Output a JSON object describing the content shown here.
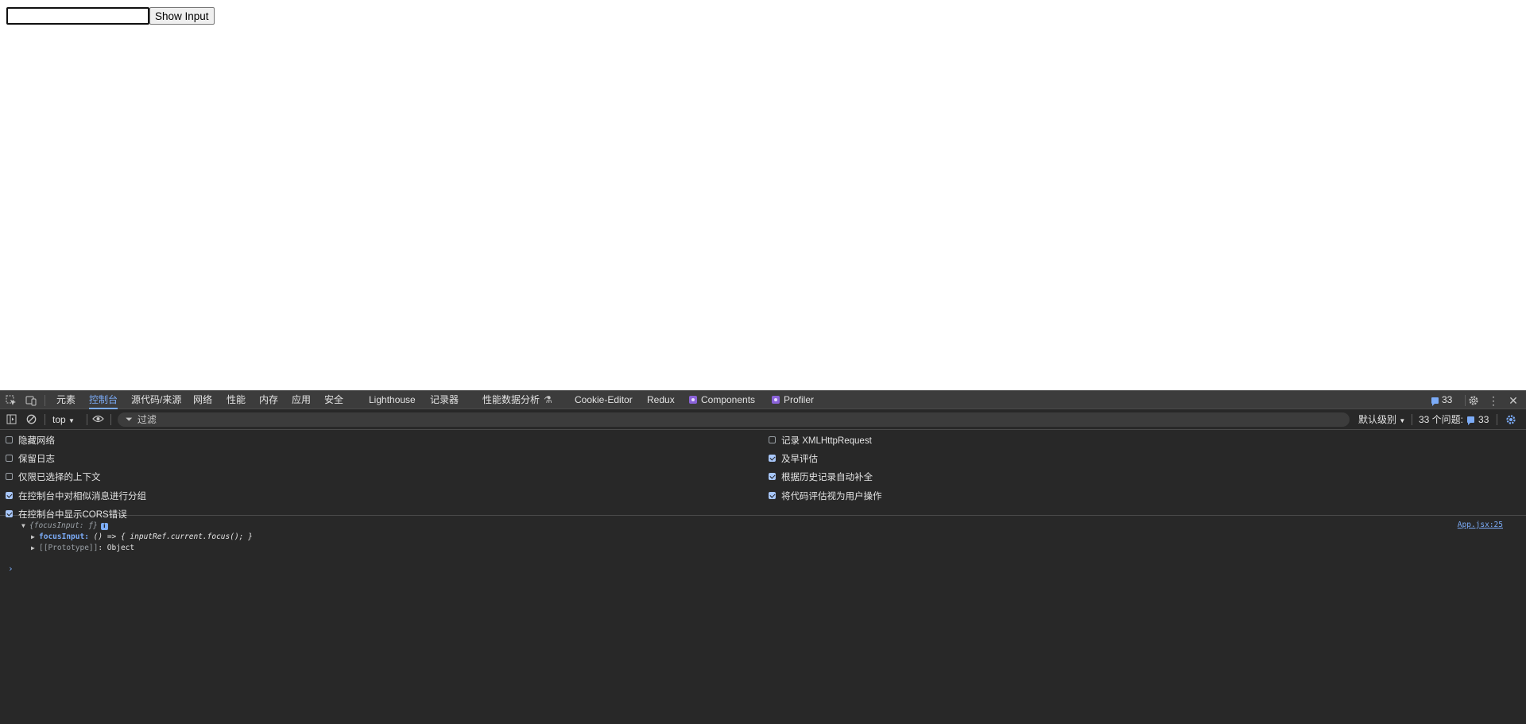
{
  "page": {
    "input_value": "",
    "button_label": "Show Input"
  },
  "devtools": {
    "tabs": [
      {
        "label": "元素"
      },
      {
        "label": "控制台",
        "active": true
      },
      {
        "label": "源代码/来源"
      },
      {
        "label": "网络"
      },
      {
        "label": "性能"
      },
      {
        "label": "内存"
      },
      {
        "label": "应用"
      },
      {
        "label": "安全"
      },
      {
        "label": "Lighthouse"
      },
      {
        "label": "记录器"
      },
      {
        "label": "性能数据分析"
      },
      {
        "label": "Cookie-Editor"
      },
      {
        "label": "Redux"
      },
      {
        "label": "Components"
      },
      {
        "label": "Profiler"
      }
    ],
    "issue_badge_count": "33",
    "toolbar": {
      "context": "top",
      "filter_placeholder": "过滤",
      "level": "默认级别",
      "issues_label": "33 个问题:",
      "issues_count": "33"
    },
    "settings_left": [
      {
        "label": "隐藏网络",
        "checked": false
      },
      {
        "label": "保留日志",
        "checked": false
      },
      {
        "label": "仅限已选择的上下文",
        "checked": false
      },
      {
        "label": "在控制台中对相似消息进行分组",
        "checked": true
      },
      {
        "label": "在控制台中显示CORS错误",
        "checked": true
      }
    ],
    "settings_right": [
      {
        "label": "记录 XMLHttpRequest",
        "checked": false
      },
      {
        "label": "及早评估",
        "checked": true
      },
      {
        "label": "根据历史记录自动补全",
        "checked": true
      },
      {
        "label": "将代码评估视为用户操作",
        "checked": true
      }
    ],
    "console": {
      "object_summary": "{focusInput: ƒ}",
      "info_badge": "i",
      "prop_key": "focusInput:",
      "prop_value": "() => { inputRef.current.focus(); }",
      "proto_key": "[[Prototype]]",
      "proto_value": ": Object",
      "source_link": "App.jsx:25",
      "prompt": "›"
    }
  }
}
